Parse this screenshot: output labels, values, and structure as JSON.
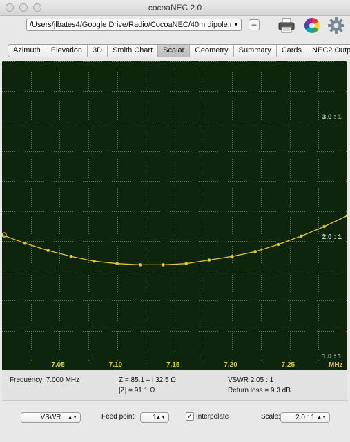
{
  "window": {
    "title": "cocoaNEC 2.0"
  },
  "toolbar": {
    "file_path": "/Users/jlbates4/Google Drive/Radio/CocoaNEC/40m dipole.nec",
    "minus_label": "–",
    "print_icon": "printer-icon",
    "color_icon": "color-wheel-icon",
    "settings_icon": "gear-icon"
  },
  "tabs": [
    {
      "label": "Azimuth"
    },
    {
      "label": "Elevation"
    },
    {
      "label": "3D"
    },
    {
      "label": "Smith Chart"
    },
    {
      "label": "Scalar",
      "active": true
    },
    {
      "label": "Geometry"
    },
    {
      "label": "Summary"
    },
    {
      "label": "Cards"
    },
    {
      "label": "NEC2 Output"
    }
  ],
  "chart_data": {
    "type": "line",
    "x_unit": "MHz",
    "x_ticks": [
      "7.05",
      "7.10",
      "7.15",
      "7.20",
      "7.25"
    ],
    "y_tick_labels": [
      "3.0 : 1",
      "2.0 : 1",
      "1.0 : 1"
    ],
    "ylim": [
      1.0,
      3.5
    ],
    "xlim": [
      7.0,
      7.3
    ],
    "grid": true,
    "series": [
      {
        "color": "#e2c63a",
        "x": [
          7.0,
          7.02,
          7.04,
          7.06,
          7.08,
          7.1,
          7.12,
          7.14,
          7.16,
          7.18,
          7.2,
          7.22,
          7.24,
          7.26,
          7.28,
          7.3
        ],
        "y": [
          2.05,
          1.98,
          1.92,
          1.87,
          1.83,
          1.81,
          1.8,
          1.8,
          1.81,
          1.84,
          1.87,
          1.91,
          1.97,
          2.04,
          2.12,
          2.21
        ]
      }
    ],
    "colors": {
      "background": "#0d250d",
      "grid": "#5f745f",
      "trace": "#e2c63a",
      "label": "#bcd8bc"
    }
  },
  "readout": {
    "frequency": "Frequency: 7.000 MHz",
    "impedance": "Z = 85.1 – i 32.5 Ω",
    "magnitude": "|Z| = 91.1 Ω",
    "vswr": "VSWR 2.05 : 1",
    "return_loss": "Return loss = 9.3 dB"
  },
  "controls": {
    "plot_type": "VSWR",
    "feed_point_label": "Feed point:",
    "feed_point_value": "1",
    "interpolate_label": "Interpolate",
    "interpolate_checked": "✓",
    "scale_label": "Scale:",
    "scale_value": "2.0 : 1"
  }
}
